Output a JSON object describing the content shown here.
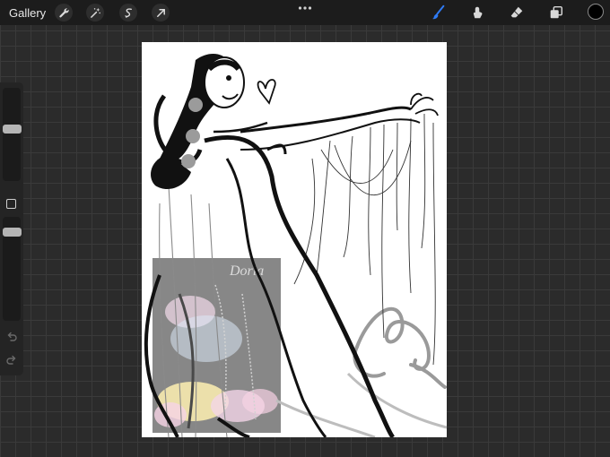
{
  "topbar": {
    "gallery_label": "Gallery",
    "left_tools": [
      "wrench-icon",
      "magic-wand-icon",
      "selection-icon",
      "transform-arrow-icon"
    ],
    "more_icon": "more-dots-icon",
    "right_tools": [
      "brush-icon",
      "smudge-icon",
      "eraser-icon",
      "layers-icon"
    ],
    "active_tool": "brush-icon",
    "accent_color": "#2f7bf5",
    "current_color": "#000000"
  },
  "sidebar": {
    "brush_size_slider": "brush-size-slider",
    "modify_button": "eyedropper-modify-button",
    "opacity_slider": "brush-opacity-slider",
    "undo_icon": "undo-icon",
    "redo_icon": "redo-icon"
  },
  "canvas": {
    "background_color": "#ffffff",
    "reference_title": "Doria"
  }
}
